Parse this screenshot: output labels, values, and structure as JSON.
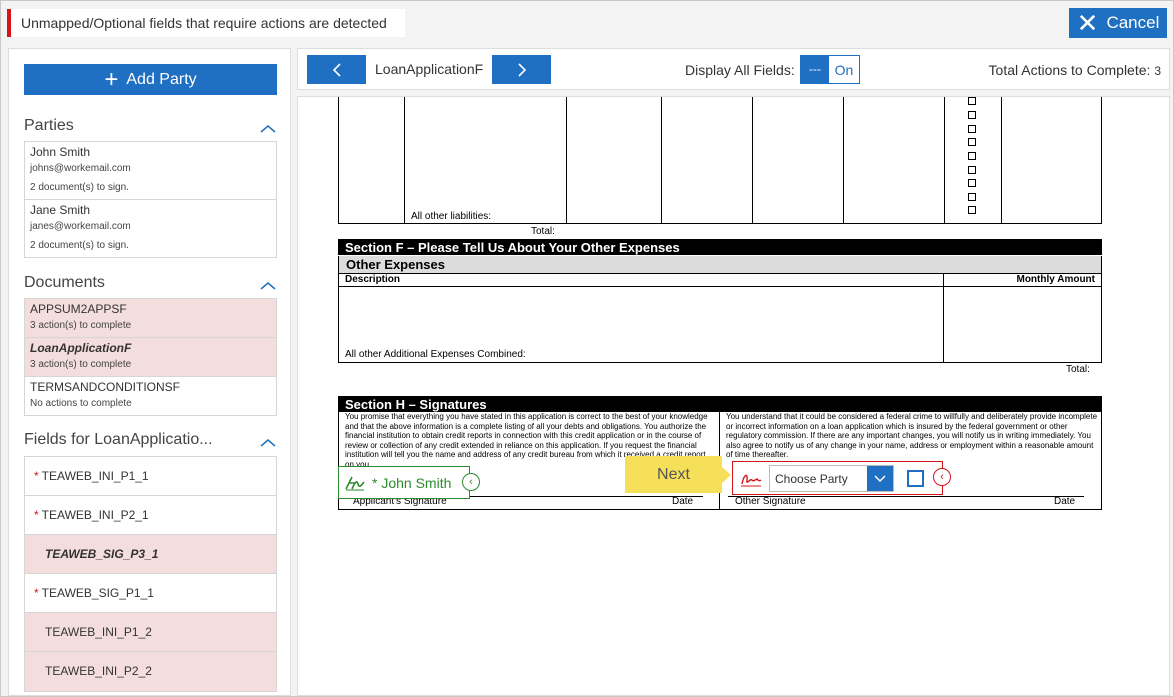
{
  "alert": {
    "text": "Unmapped/Optional fields that require actions are detected"
  },
  "cancel": {
    "label": "Cancel"
  },
  "sidebar": {
    "add_party_label": "Add Party",
    "parties_title": "Parties",
    "parties": [
      {
        "name": "John Smith",
        "email": "johns@workemail.com",
        "status": "2 document(s) to sign."
      },
      {
        "name": "Jane Smith",
        "email": "janes@workemail.com",
        "status": "2 document(s) to sign."
      }
    ],
    "documents_title": "Documents",
    "documents": [
      {
        "name": "APPSUM2APPSF",
        "status": "3 action(s) to complete"
      },
      {
        "name": "LoanApplicationF",
        "status": "3 action(s) to complete"
      },
      {
        "name": "TERMSANDCONDITIONSF",
        "status": "No actions to complete"
      }
    ],
    "fields_title": "Fields for LoanApplicatio...",
    "fields": [
      {
        "label": "TEAWEB_INI_P1_1",
        "required": "*"
      },
      {
        "label": "TEAWEB_INI_P2_1",
        "required": "*"
      },
      {
        "label": "TEAWEB_SIG_P3_1",
        "required": ""
      },
      {
        "label": "TEAWEB_SIG_P1_1",
        "required": "*"
      },
      {
        "label": "TEAWEB_INI_P1_2",
        "required": ""
      },
      {
        "label": "TEAWEB_INI_P2_2",
        "required": ""
      }
    ]
  },
  "toolbar": {
    "prev_icon": "chevron-left-icon",
    "doc_name": "LoanApplicationF",
    "next_icon": "chevron-right-icon",
    "display_all_label": "Display All Fields:",
    "toggle_off": "---",
    "toggle_on": "On",
    "total_label": "Total Actions to Complete:",
    "total_count": "3"
  },
  "doc": {
    "liabilities_label": "All other liabilities:",
    "total1": "Total:",
    "section_f": "Section F – Please Tell Us About Your Other Expenses",
    "other_expenses": "Other Expenses",
    "description": "Description",
    "monthly_amount": "Monthly Amount",
    "additional_expenses": "All other Additional Expenses Combined:",
    "total2": "Total:",
    "section_h": "Section H – Signatures",
    "left_para": "You promise that everything you have stated in this application is correct to the best of your knowledge and that the above information is a complete listing of all your debts and obligations. You authorize the financial institution to obtain credit reports in connection with this credit application or in the course of review or collection of any credit extended in reliance on this application.  If you request the financial institution will tell you the name and address of any credit bureau from which it received a credit report on you.",
    "right_para": "You understand that it could be considered a federal crime to willfully and deliberately provide incomplete or incorrect information on a loan application which is insured by the federal government or other regulatory commission. If there are any important changes, you will notify us in writing immediately.  You also agree to notify us of any change in your name, address or employment within a reasonable amount of time thereafter.",
    "applicant_sig": "Applicant's Signature",
    "date1": "Date",
    "other_sig": "Other Signature",
    "date2": "Date"
  },
  "overlays": {
    "next_label": "Next",
    "john_tag": "* John Smith",
    "choose_party": "Choose Party"
  }
}
